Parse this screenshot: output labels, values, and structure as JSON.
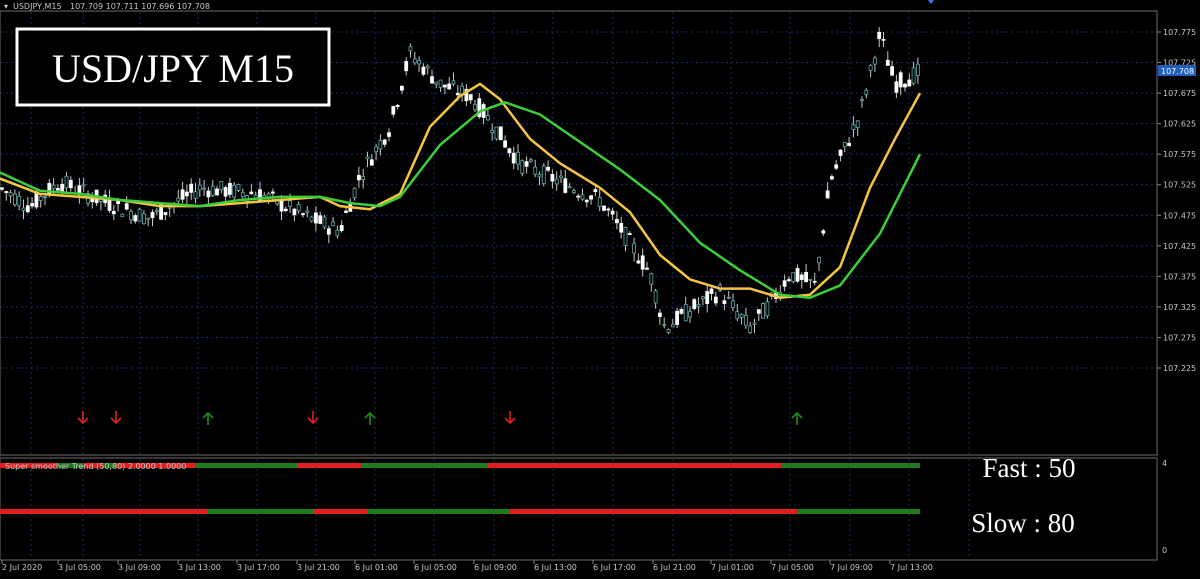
{
  "header": {
    "symbol_info": "USDJPY,M15",
    "ohlc": "107.709 107.711 107.696 107.708"
  },
  "title_box": "USD/JPY M15",
  "indicator": {
    "name": "Super smoother Trend (50,80) 2.0000 1.0000",
    "scale_top": "4",
    "scale_bottom": "0",
    "fast_text": "Fast : 50",
    "slow_text": "Slow : 80"
  },
  "price_axis": {
    "labels": [
      "107.775",
      "107.725",
      "107.675",
      "107.625",
      "107.575",
      "107.525",
      "107.475",
      "107.425",
      "107.375",
      "107.325",
      "107.275",
      "107.225"
    ],
    "current_price": "107.708"
  },
  "time_axis": {
    "labels": [
      "2 Jul 2020",
      "3 Jul 05:00",
      "3 Jul 09:00",
      "3 Jul 13:00",
      "3 Jul 17:00",
      "3 Jul 21:00",
      "6 Jul 01:00",
      "6 Jul 05:00",
      "6 Jul 09:00",
      "6 Jul 13:00",
      "6 Jul 17:00",
      "6 Jul 21:00",
      "7 Jul 01:00",
      "7 Jul 05:00",
      "7 Jul 09:00",
      "7 Jul 13:00"
    ]
  },
  "colors": {
    "background": "#000000",
    "grid": "#1a2a6c",
    "bull_candle": "#ffffff",
    "bear_candle": "#ffffff",
    "fast_ma": "#f5c542",
    "slow_ma": "#3ccf3c",
    "bar_up": "#1d7a1d",
    "bar_down": "#e02020",
    "arrow_up": "#1e8c1e",
    "arrow_down": "#e02020",
    "axis_text": "#c8c8c8",
    "price_tag": "#1f5fbf"
  },
  "chart_data": {
    "type": "line",
    "title": "USD/JPY M15",
    "ylim": [
      107.225,
      107.8
    ],
    "series": [
      {
        "name": "Fast : 50",
        "color": "#f5c542",
        "points": [
          [
            0,
            107.535
          ],
          [
            40,
            107.51
          ],
          [
            80,
            107.505
          ],
          [
            120,
            107.5
          ],
          [
            160,
            107.49
          ],
          [
            200,
            107.49
          ],
          [
            240,
            107.495
          ],
          [
            280,
            107.5
          ],
          [
            320,
            107.505
          ],
          [
            340,
            107.49
          ],
          [
            370,
            107.485
          ],
          [
            400,
            107.51
          ],
          [
            430,
            107.62
          ],
          [
            460,
            107.67
          ],
          [
            480,
            107.69
          ],
          [
            500,
            107.665
          ],
          [
            530,
            107.6
          ],
          [
            560,
            107.56
          ],
          [
            600,
            107.52
          ],
          [
            630,
            107.48
          ],
          [
            660,
            107.41
          ],
          [
            690,
            107.37
          ],
          [
            720,
            107.355
          ],
          [
            750,
            107.355
          ],
          [
            780,
            107.34
          ],
          [
            810,
            107.345
          ],
          [
            840,
            107.39
          ],
          [
            870,
            107.52
          ],
          [
            895,
            107.6
          ],
          [
            920,
            107.675
          ]
        ]
      },
      {
        "name": "Slow : 80",
        "color": "#3ccf3c",
        "points": [
          [
            0,
            107.545
          ],
          [
            40,
            107.515
          ],
          [
            80,
            107.51
          ],
          [
            120,
            107.5
          ],
          [
            160,
            107.495
          ],
          [
            200,
            107.49
          ],
          [
            240,
            107.5
          ],
          [
            280,
            107.505
          ],
          [
            320,
            107.505
          ],
          [
            350,
            107.495
          ],
          [
            380,
            107.49
          ],
          [
            400,
            107.505
          ],
          [
            440,
            107.59
          ],
          [
            480,
            107.645
          ],
          [
            505,
            107.66
          ],
          [
            540,
            107.64
          ],
          [
            580,
            107.595
          ],
          [
            620,
            107.55
          ],
          [
            660,
            107.5
          ],
          [
            700,
            107.43
          ],
          [
            740,
            107.385
          ],
          [
            780,
            107.345
          ],
          [
            810,
            107.34
          ],
          [
            840,
            107.36
          ],
          [
            880,
            107.445
          ],
          [
            920,
            107.575
          ]
        ]
      }
    ],
    "indicator_rows": [
      {
        "name": "Fast : 50",
        "segments": [
          {
            "from": 0,
            "to": 57,
            "state": "down"
          },
          {
            "from": 57,
            "to": 83,
            "state": "up"
          },
          {
            "from": 83,
            "to": 104,
            "state": "down"
          },
          {
            "from": 104,
            "to": 116,
            "state": "up"
          },
          {
            "from": 116,
            "to": 195,
            "state": "down"
          },
          {
            "from": 195,
            "to": 297,
            "state": "up"
          },
          {
            "from": 297,
            "to": 361,
            "state": "down"
          },
          {
            "from": 361,
            "to": 487,
            "state": "up"
          },
          {
            "from": 487,
            "to": 781,
            "state": "down"
          },
          {
            "from": 781,
            "to": 920,
            "state": "up"
          }
        ]
      },
      {
        "name": "Slow : 80",
        "segments": [
          {
            "from": 0,
            "to": 208,
            "state": "down"
          },
          {
            "from": 208,
            "to": 313,
            "state": "up"
          },
          {
            "from": 313,
            "to": 367,
            "state": "down"
          },
          {
            "from": 367,
            "to": 510,
            "state": "up"
          },
          {
            "from": 510,
            "to": 797,
            "state": "down"
          },
          {
            "from": 797,
            "to": 920,
            "state": "up"
          }
        ]
      }
    ],
    "signals": [
      {
        "at": 83,
        "dir": "down"
      },
      {
        "at": 116,
        "dir": "down"
      },
      {
        "at": 208,
        "dir": "up"
      },
      {
        "at": 313,
        "dir": "down"
      },
      {
        "at": 370,
        "dir": "up"
      },
      {
        "at": 510,
        "dir": "down"
      },
      {
        "at": 797,
        "dir": "up"
      }
    ]
  }
}
